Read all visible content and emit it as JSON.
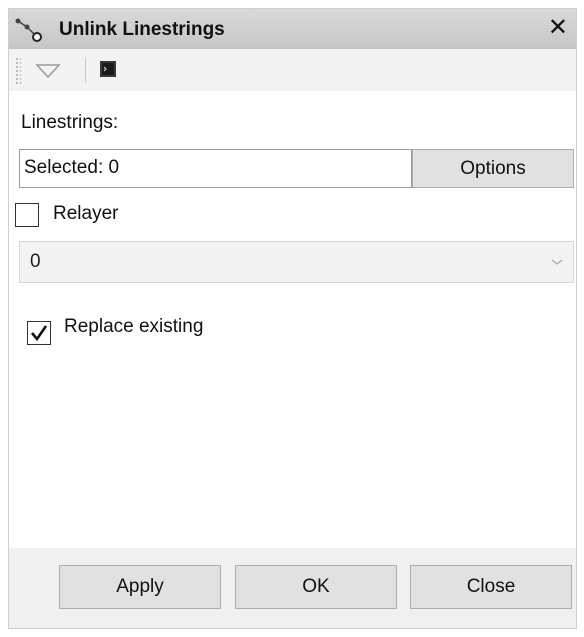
{
  "window": {
    "title": "Unlink Linestrings",
    "close_glyph": "✕"
  },
  "toolbar": {
    "icons": [
      "dropdown-arrow-icon",
      "console-icon"
    ]
  },
  "form": {
    "linestrings_label": "Linestrings:",
    "selected_value": "Selected: 0",
    "options_label": "Options",
    "relayer_label": "Relayer",
    "relayer_checked": false,
    "layer_value": "0",
    "replace_label": "Replace existing",
    "replace_checked": true
  },
  "footer": {
    "apply_label": "Apply",
    "ok_label": "OK",
    "close_label": "Close"
  },
  "colors": {
    "titlebar": "#c8c8c8",
    "panel_background": "#f0f0f0",
    "button_background": "#e1e1e1"
  }
}
